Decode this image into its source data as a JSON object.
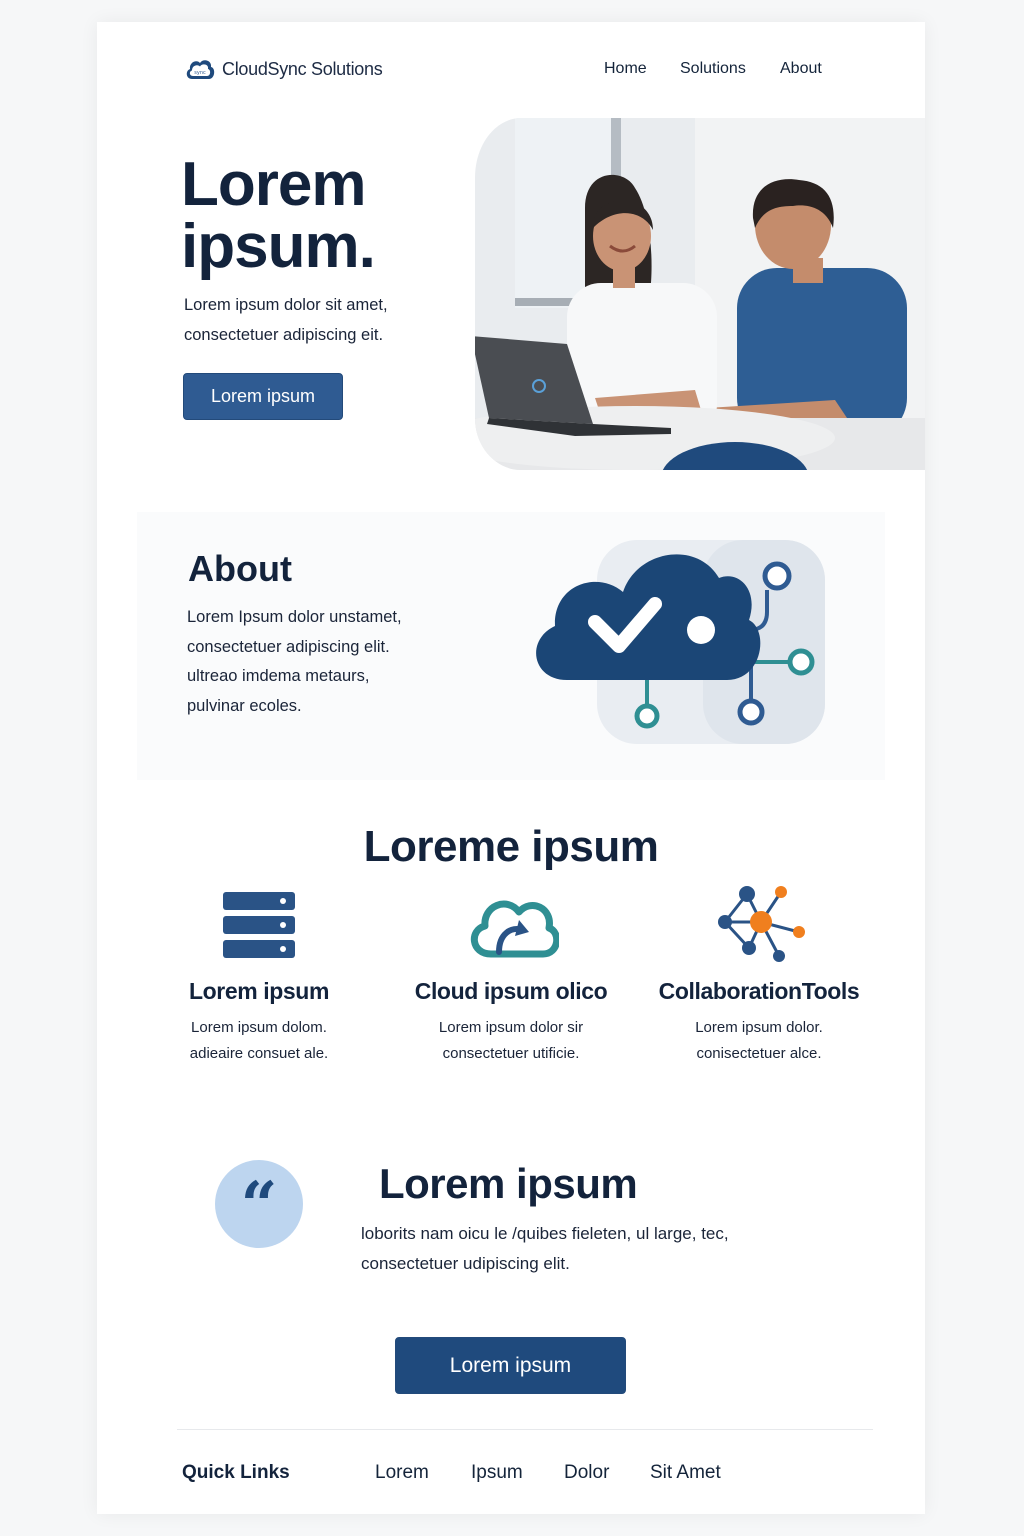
{
  "header": {
    "brand": "CloudSync Solutions",
    "nav": [
      "Home",
      "Solutions",
      "About"
    ]
  },
  "hero": {
    "title_line1": "Lorem",
    "title_line2": "ipsum.",
    "text_line1": "Lorem ipsum dolor sit amet,",
    "text_line2": "consectetuer adipiscing eit.",
    "button": "Lorem ipsum"
  },
  "about": {
    "title": "About",
    "lines": [
      "Lorem Ipsum dolor unstamet,",
      "consectetuer adipiscing elit.",
      "ultreao imdema metaurs,",
      "pulvinar ecoles."
    ]
  },
  "features": {
    "title": "Loreme ipsum",
    "items": [
      {
        "icon": "server-icon",
        "title": "Lorem ipsum",
        "line1": "Lorem ipsum dolom.",
        "line2": "adieaire consuet ale."
      },
      {
        "icon": "cloud-sync-icon",
        "title": "Cloud ipsum olico",
        "line1": "Lorem ipsum dolor sir",
        "line2": "consectetuer utificie."
      },
      {
        "icon": "network-icon",
        "title": "CollaborationTools",
        "line1": "Lorem ipsum dolor.",
        "line2": "conisectetuer alce."
      }
    ]
  },
  "testimonial": {
    "quote_mark": "“",
    "title": "Lorem ipsum",
    "line1": "loborits nam oicu le /quibes fieleten, ul large, tec,",
    "line2": "consectetuer udipiscing elit.",
    "button": "Lorem ipsum"
  },
  "footer": {
    "label": "Quick Links",
    "links": [
      "Lorem",
      "Ipsum",
      "Dolor",
      "Sit Amet"
    ]
  },
  "colors": {
    "primary": "#2f5b92",
    "dark_navy": "#1f4a7d",
    "heading": "#13233c",
    "teal": "#2f8f93",
    "orange": "#f07f1e",
    "quote_bg": "#bdd5ef"
  }
}
